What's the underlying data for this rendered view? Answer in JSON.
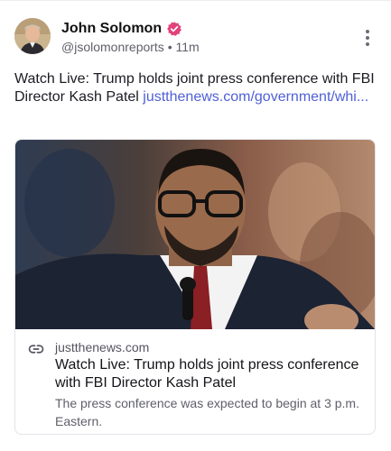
{
  "post": {
    "author_name": "John Solomon",
    "handle": "@jsolomonreports",
    "separator": "•",
    "time_ago": "11m",
    "text": "Watch Live: Trump holds joint press conference with FBI Director Kash Patel ",
    "link_text": "justthenews.com/government/whi...",
    "verified_badge_color": "#e2427b",
    "link_color": "#4f5fd6"
  },
  "card": {
    "domain": "justthenews.com",
    "title": "Watch Live: Trump holds joint press conference with FBI Director Kash Patel",
    "description": "The press conference was expected to begin at 3 p.m. Eastern."
  },
  "icons": {
    "verified": "verified-badge-icon",
    "more": "more-vertical-icon",
    "link": "link-icon"
  }
}
